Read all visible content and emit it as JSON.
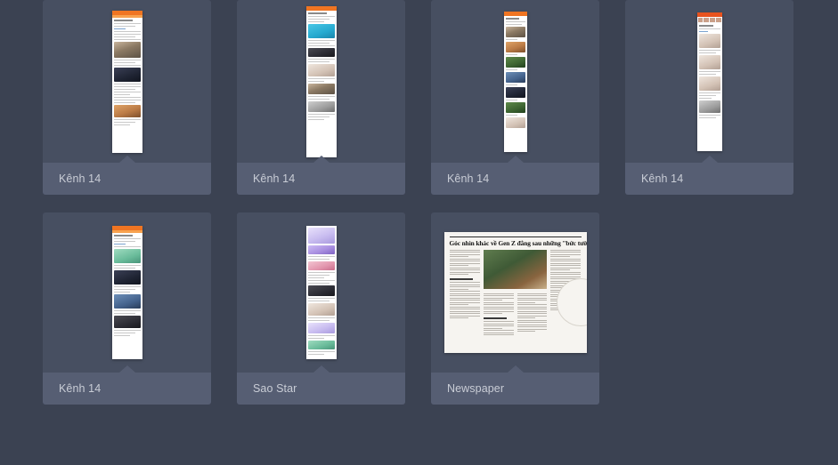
{
  "page": {
    "background_color": "#3b4252",
    "card_body_color": "#474f61",
    "card_label_color": "#565e73",
    "label_text_color": "#c9cdd6"
  },
  "gallery": {
    "rows": [
      {
        "cards": [
          {
            "label": "Kênh 14",
            "thumb_kind": "article-orange",
            "source": "kenh14"
          },
          {
            "label": "Kênh 14",
            "thumb_kind": "article-orange",
            "source": "kenh14"
          },
          {
            "label": "Kênh 14",
            "thumb_kind": "article-photolist",
            "source": "kenh14"
          },
          {
            "label": "Kênh 14",
            "thumb_kind": "article-gallery",
            "source": "kenh14"
          }
        ]
      },
      {
        "cards": [
          {
            "label": "Kênh 14",
            "thumb_kind": "article-orange",
            "source": "kenh14"
          },
          {
            "label": "Sao Star",
            "thumb_kind": "article-illustrated",
            "source": "saostar"
          },
          {
            "label": "Newspaper",
            "thumb_kind": "newspaper-page",
            "source": "newspaper"
          }
        ]
      }
    ]
  },
  "newspaper": {
    "headline": "Góc nhìn khác về Gen Z đằng sau những \"bức tường\""
  }
}
